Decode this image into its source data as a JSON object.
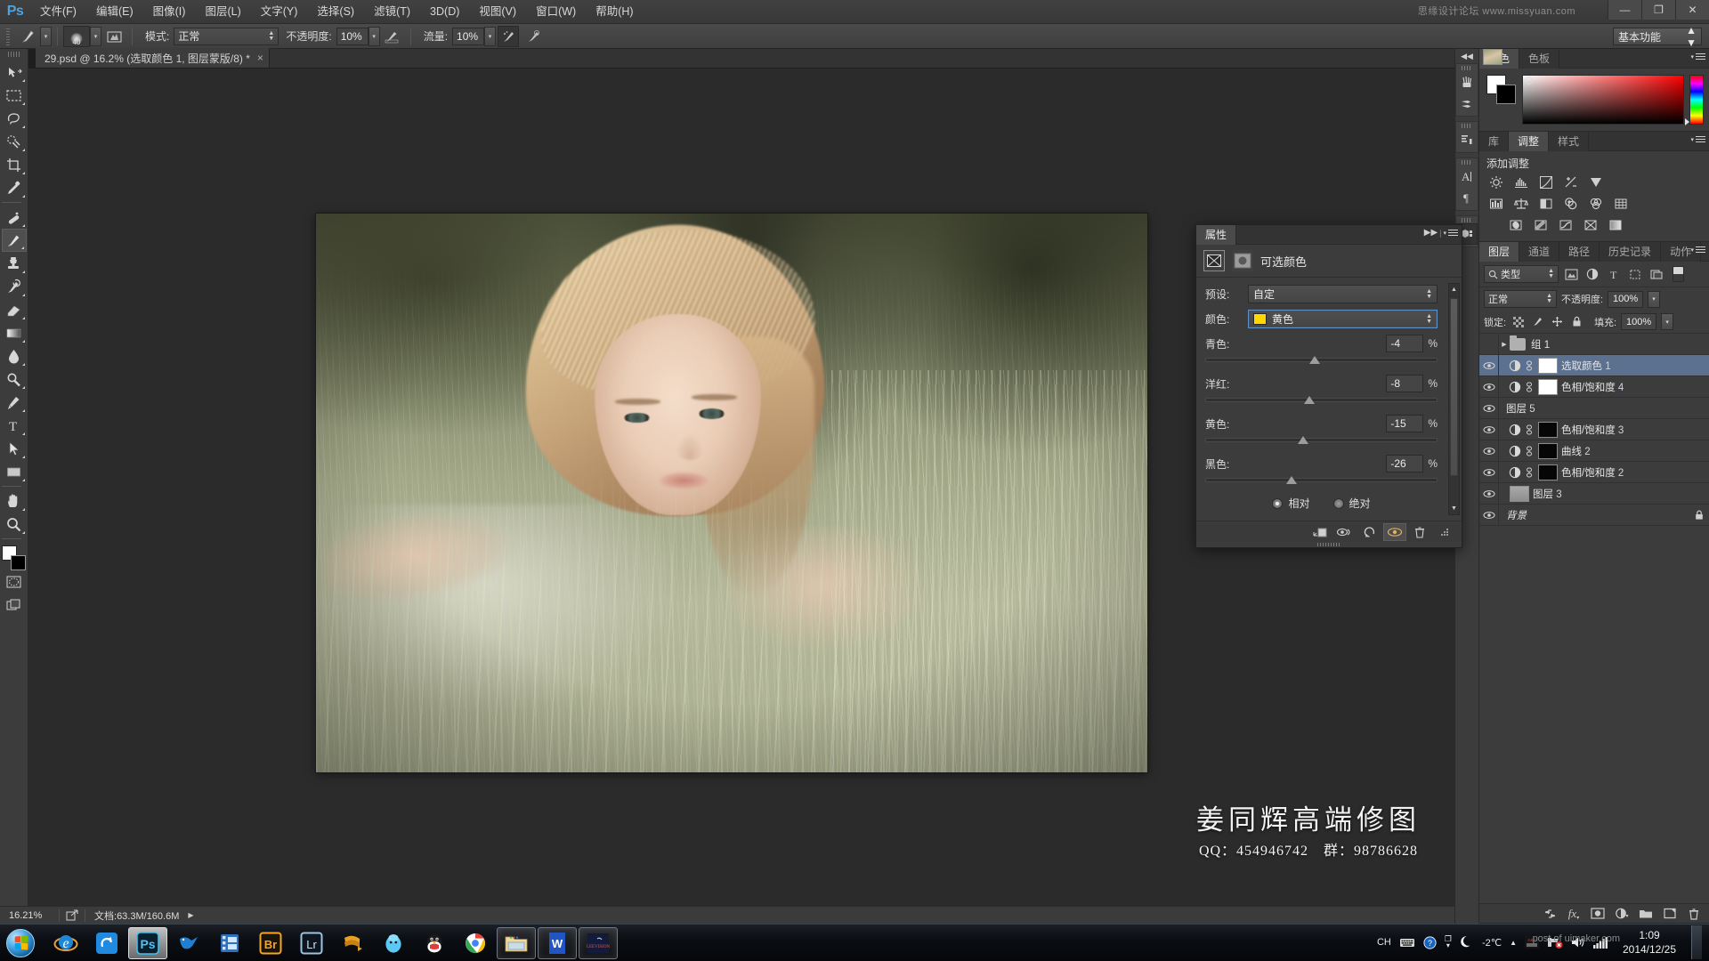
{
  "app": {
    "logo": "Ps",
    "title_watermark": "思缘设计论坛 www.missyuan.com",
    "window_buttons": {
      "minimize": "—",
      "restore": "❐",
      "close": "✕"
    }
  },
  "menu": {
    "items": [
      {
        "label": "文件(F)",
        "name": "menu-file"
      },
      {
        "label": "编辑(E)",
        "name": "menu-edit"
      },
      {
        "label": "图像(I)",
        "name": "menu-image"
      },
      {
        "label": "图层(L)",
        "name": "menu-layer"
      },
      {
        "label": "文字(Y)",
        "name": "menu-type"
      },
      {
        "label": "选择(S)",
        "name": "menu-select"
      },
      {
        "label": "滤镜(T)",
        "name": "menu-filter"
      },
      {
        "label": "3D(D)",
        "name": "menu-3d"
      },
      {
        "label": "视图(V)",
        "name": "menu-view"
      },
      {
        "label": "窗口(W)",
        "name": "menu-window"
      },
      {
        "label": "帮助(H)",
        "name": "menu-help"
      }
    ]
  },
  "options_bar": {
    "brush_size": "40",
    "mode_label": "模式:",
    "mode_value": "正常",
    "opacity_label": "不透明度:",
    "opacity_value": "10%",
    "flow_label": "流量:",
    "flow_value": "10%",
    "workspace": "基本功能"
  },
  "document_tab": {
    "title": "29.psd @ 16.2% (选取颜色 1, 图层蒙版/8) *",
    "close": "×"
  },
  "toolbar": {
    "tools": [
      {
        "name": "move-tool",
        "label": "移动工具",
        "active": false
      },
      {
        "name": "rectangular-marquee-tool",
        "label": "矩形选框工具",
        "active": false
      },
      {
        "name": "lasso-tool",
        "label": "套索工具",
        "active": false
      },
      {
        "name": "quick-selection-tool",
        "label": "快速选择工具",
        "active": false
      },
      {
        "name": "crop-tool",
        "label": "裁剪工具",
        "active": false
      },
      {
        "name": "eyedropper-tool",
        "label": "吸管工具",
        "active": false
      },
      {
        "name": "spot-healing-brush-tool",
        "label": "污点修复画笔工具",
        "active": false
      },
      {
        "name": "brush-tool",
        "label": "画笔工具",
        "active": true
      },
      {
        "name": "clone-stamp-tool",
        "label": "仿制图章工具",
        "active": false
      },
      {
        "name": "history-brush-tool",
        "label": "历史记录画笔工具",
        "active": false
      },
      {
        "name": "eraser-tool",
        "label": "橡皮擦工具",
        "active": false
      },
      {
        "name": "gradient-tool",
        "label": "渐变工具",
        "active": false
      },
      {
        "name": "blur-tool",
        "label": "模糊工具",
        "active": false
      },
      {
        "name": "dodge-tool",
        "label": "减淡工具",
        "active": false
      },
      {
        "name": "pen-tool",
        "label": "钢笔工具",
        "active": false
      },
      {
        "name": "horizontal-type-tool",
        "label": "横排文字工具",
        "active": false
      },
      {
        "name": "path-selection-tool",
        "label": "路径选择工具",
        "active": false
      },
      {
        "name": "rectangle-tool",
        "label": "矩形工具",
        "active": false
      },
      {
        "name": "hand-tool",
        "label": "抓手工具",
        "active": false
      },
      {
        "name": "zoom-tool",
        "label": "缩放工具",
        "active": false
      }
    ],
    "foreground_color": "#ffffff",
    "background_color": "#000000"
  },
  "status_bar": {
    "zoom": "16.21%",
    "doc_label": "文档:",
    "doc_value": "63.3M/160.6M",
    "arrow": "▶"
  },
  "canvas": {
    "watermark_main": "姜同辉高端修图",
    "watermark_sub": "QQ：454946742　群：98786628"
  },
  "rail": {
    "collapse": "◀◀",
    "icons": [
      {
        "name": "brushes-panel-icon",
        "glyph": "brush"
      },
      {
        "name": "brush-presets-panel-icon",
        "glyph": "presets"
      },
      {
        "name": "histogram-panel-icon",
        "glyph": "histogram"
      },
      {
        "name": "character-panel-icon",
        "glyph": "A"
      },
      {
        "name": "paragraph-panel-icon",
        "glyph": "¶"
      },
      {
        "name": "3d-panel-icon",
        "glyph": "cube"
      }
    ]
  },
  "color_panel": {
    "tabs": [
      {
        "label": "颜色",
        "active": true
      },
      {
        "label": "色板",
        "active": false
      }
    ],
    "foreground": "#ffffff",
    "background": "#000000"
  },
  "adjustments_panel": {
    "tabs": [
      {
        "label": "库",
        "active": false
      },
      {
        "label": "调整",
        "active": true
      },
      {
        "label": "样式",
        "active": false
      }
    ],
    "title": "添加调整",
    "rows": [
      [
        "brightness-contrast",
        "levels",
        "curves",
        "exposure",
        "vibrance"
      ],
      [
        "hue-saturation",
        "color-balance",
        "black-white",
        "photo-filter",
        "channel-mixer",
        "color-lookup"
      ],
      [
        "invert",
        "posterize",
        "threshold",
        "gradient-map",
        "selective-color"
      ]
    ]
  },
  "properties_panel": {
    "tab_label": "属性",
    "collapse": "▶▶",
    "adjustment_title": "可选颜色",
    "preset_label": "预设:",
    "preset_value": "自定",
    "color_label": "颜色:",
    "color_value": "黄色",
    "color_swatch": "#ffd800",
    "sliders": [
      {
        "name": "cyan",
        "label": "青色:",
        "value": "-4",
        "unit": "%",
        "pos": 47
      },
      {
        "name": "magenta",
        "label": "洋红:",
        "value": "-8",
        "unit": "%",
        "pos": 45
      },
      {
        "name": "yellow",
        "label": "黄色:",
        "value": "-15",
        "unit": "%",
        "pos": 42
      },
      {
        "name": "black",
        "label": "黑色:",
        "value": "-26",
        "unit": "%",
        "pos": 37
      }
    ],
    "radio_relative": "相对",
    "radio_absolute": "绝对",
    "radio_selected": "相对",
    "footer_icons": [
      {
        "name": "clip-to-layer-icon"
      },
      {
        "name": "toggle-layer-visibility-icon"
      },
      {
        "name": "reset-adjustment-icon"
      },
      {
        "name": "preview-eye-icon"
      },
      {
        "name": "delete-adjustment-icon"
      }
    ]
  },
  "layers_panel": {
    "tabs": [
      {
        "label": "图层",
        "active": true
      },
      {
        "label": "通道",
        "active": false
      },
      {
        "label": "路径",
        "active": false
      },
      {
        "label": "历史记录",
        "active": false
      },
      {
        "label": "动作",
        "active": false
      }
    ],
    "filter_kind": "类型",
    "blend_mode": "正常",
    "opacity_label": "不透明度:",
    "opacity_value": "100%",
    "lock_label": "锁定:",
    "fill_label": "填充:",
    "fill_value": "100%",
    "layers": [
      {
        "name": "组 1",
        "index": "",
        "type": "group",
        "visible": false,
        "selected": false,
        "thumb": "none",
        "locked": false
      },
      {
        "name": "选取颜色",
        "index": "1",
        "type": "adjustment",
        "visible": true,
        "selected": true,
        "thumb": "white",
        "locked": false
      },
      {
        "name": "色相/饱和度",
        "index": "4",
        "type": "adjustment",
        "visible": true,
        "selected": false,
        "thumb": "white",
        "locked": false
      },
      {
        "name": "图层",
        "index": "5",
        "type": "pixel",
        "visible": true,
        "selected": false,
        "thumb": "photo",
        "locked": false
      },
      {
        "name": "色相/饱和度",
        "index": "3",
        "type": "adjustment",
        "visible": true,
        "selected": false,
        "thumb": "black",
        "locked": false
      },
      {
        "name": "曲线",
        "index": "2",
        "type": "adjustment",
        "visible": true,
        "selected": false,
        "thumb": "black",
        "locked": false
      },
      {
        "name": "色相/饱和度",
        "index": "2",
        "type": "adjustment",
        "visible": true,
        "selected": false,
        "thumb": "black",
        "locked": false
      },
      {
        "name": "图层",
        "index": "3",
        "type": "pixel",
        "visible": true,
        "selected": false,
        "thumb": "gray",
        "locked": false
      },
      {
        "name": "背景",
        "index": "",
        "type": "background",
        "visible": true,
        "selected": false,
        "thumb": "photo",
        "locked": true
      }
    ],
    "footer_icons": [
      {
        "name": "link-layers-icon"
      },
      {
        "name": "layer-style-fx-icon"
      },
      {
        "name": "add-layer-mask-icon"
      },
      {
        "name": "new-adjustment-layer-icon"
      },
      {
        "name": "new-group-icon"
      },
      {
        "name": "new-layer-icon"
      },
      {
        "name": "delete-layer-icon"
      }
    ]
  },
  "taskbar": {
    "start_label": "开始",
    "apps": [
      {
        "name": "internet-explorer",
        "state": "pinned"
      },
      {
        "name": "thunder-download",
        "state": "pinned"
      },
      {
        "name": "photoshop",
        "state": "active"
      },
      {
        "name": "hummingbird-pdf",
        "state": "pinned"
      },
      {
        "name": "video-editor",
        "state": "pinned"
      },
      {
        "name": "adobe-bridge",
        "state": "pinned"
      },
      {
        "name": "adobe-lightroom",
        "state": "pinned"
      },
      {
        "name": "film-reel-tool",
        "state": "pinned"
      },
      {
        "name": "alipay-wallet",
        "state": "pinned"
      },
      {
        "name": "qq-messenger",
        "state": "pinned"
      },
      {
        "name": "google-chrome",
        "state": "pinned"
      },
      {
        "name": "file-explorer",
        "state": "running"
      },
      {
        "name": "wps-writer",
        "state": "running"
      },
      {
        "name": "leevision-app",
        "state": "running"
      }
    ],
    "tray": {
      "ime": "CH",
      "temperature": "-2℃",
      "time": "1:09",
      "date": "2014/12/25",
      "watermark": "post of uimaker.com"
    }
  }
}
